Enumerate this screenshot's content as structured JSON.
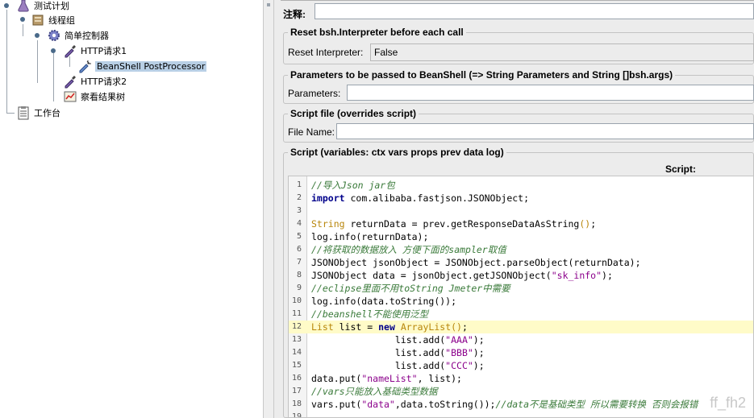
{
  "tree": {
    "items": [
      {
        "label": "测试计划",
        "icon": "test-plan-flask-icon"
      },
      {
        "label": "线程组",
        "icon": "thread-group-icon"
      },
      {
        "label": "简单控制器",
        "icon": "gear-icon"
      },
      {
        "label": "HTTP请求1",
        "icon": "pipette-icon"
      },
      {
        "label": "BeanShell PostProcessor",
        "icon": "postprocessor-icon"
      },
      {
        "label": "HTTP请求2",
        "icon": "pipette-icon"
      },
      {
        "label": "察看结果树",
        "icon": "chart-listener-icon"
      },
      {
        "label": "工作台",
        "icon": "clipboard-icon"
      }
    ]
  },
  "form": {
    "comment_label": "注释:",
    "reset_group_title": "Reset bsh.Interpreter before each call",
    "reset_label": "Reset Interpreter:",
    "reset_value": "False",
    "params_group_title": "Parameters to be passed to BeanShell (=> String Parameters and String []bsh.args)",
    "params_label": "Parameters:",
    "params_value": "",
    "file_group_title": "Script file (overrides script)",
    "file_label": "File Name:",
    "file_value": "",
    "script_group_title": "Script (variables: ctx vars props prev data log)",
    "script_label": "Script:"
  },
  "editor": {
    "highlighted_line": 12,
    "lines": [
      {
        "n": "1",
        "tokens": [
          [
            "comment",
            "//导入Json jar包"
          ]
        ]
      },
      {
        "n": "2",
        "tokens": [
          [
            "kw",
            "import"
          ],
          [
            "plain",
            " com.alibaba.fastjson.JSONObject;"
          ]
        ]
      },
      {
        "n": "3",
        "tokens": []
      },
      {
        "n": "4",
        "tokens": [
          [
            "type",
            "String"
          ],
          [
            "plain",
            " returnData = prev.getResponseDataAsString"
          ],
          [
            "type",
            "()"
          ],
          [
            "plain",
            ";"
          ]
        ]
      },
      {
        "n": "5",
        "tokens": [
          [
            "plain",
            "log.info(returnData);"
          ]
        ]
      },
      {
        "n": "6",
        "tokens": [
          [
            "comment",
            "//将获取的数据放入 方便下面的sampler取值"
          ]
        ]
      },
      {
        "n": "7",
        "tokens": [
          [
            "plain",
            "JSONObject jsonObject = JSONObject.parseObject(returnData);"
          ]
        ]
      },
      {
        "n": "8",
        "tokens": [
          [
            "plain",
            "JSONObject data = jsonObject.getJSONObject("
          ],
          [
            "str",
            "\"sk_info\""
          ],
          [
            "plain",
            ");"
          ]
        ]
      },
      {
        "n": "9",
        "tokens": [
          [
            "comment",
            "//eclipse里面不用toString Jmeter中需要"
          ]
        ]
      },
      {
        "n": "10",
        "tokens": [
          [
            "plain",
            "log.info(data.toString());"
          ]
        ]
      },
      {
        "n": "11",
        "tokens": [
          [
            "comment",
            "//beanshell不能使用泛型"
          ]
        ]
      },
      {
        "n": "12",
        "tokens": [
          [
            "type",
            "List"
          ],
          [
            "plain",
            " list = "
          ],
          [
            "kw",
            "new"
          ],
          [
            "plain",
            " "
          ],
          [
            "type",
            "ArrayList()"
          ],
          [
            "plain",
            ";"
          ]
        ]
      },
      {
        "n": "13",
        "tokens": [
          [
            "plain",
            "               list.add("
          ],
          [
            "str",
            "\"AAA\""
          ],
          [
            "plain",
            ");"
          ]
        ]
      },
      {
        "n": "14",
        "tokens": [
          [
            "plain",
            "               list.add("
          ],
          [
            "str",
            "\"BBB\""
          ],
          [
            "plain",
            ");"
          ]
        ]
      },
      {
        "n": "15",
        "tokens": [
          [
            "plain",
            "               list.add("
          ],
          [
            "str",
            "\"CCC\""
          ],
          [
            "plain",
            ");"
          ]
        ]
      },
      {
        "n": "16",
        "tokens": [
          [
            "plain",
            "data.put("
          ],
          [
            "str",
            "\"nameList\""
          ],
          [
            "plain",
            ", list);"
          ]
        ]
      },
      {
        "n": "17",
        "tokens": [
          [
            "comment",
            "//vars只能放入基础类型数据"
          ]
        ]
      },
      {
        "n": "18",
        "tokens": [
          [
            "plain",
            "vars.put("
          ],
          [
            "str",
            "\"data\""
          ],
          [
            "plain",
            ",data.toString());"
          ],
          [
            "comment",
            "//data不是基础类型 所以需要转换 否则会报错"
          ]
        ]
      },
      {
        "n": "19",
        "tokens": []
      }
    ]
  },
  "watermark": "ff_fh2"
}
